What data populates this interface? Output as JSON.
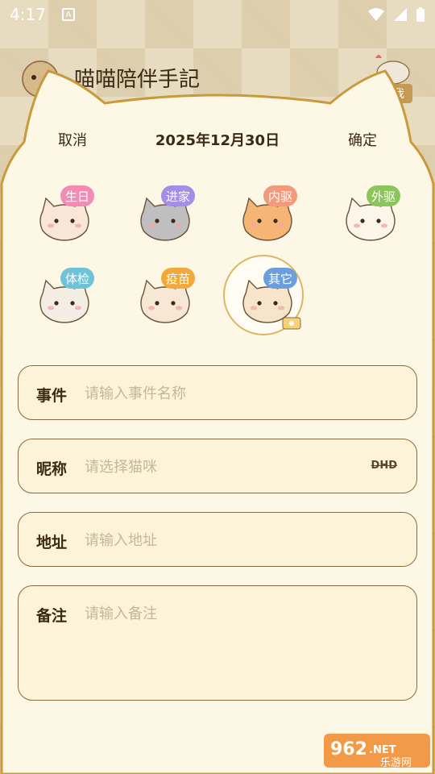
{
  "status_bar": {
    "time": "4:17",
    "notification_icon": "A"
  },
  "app": {
    "title_partial": "喵喵陪伴手記",
    "me_button": "我"
  },
  "picker": {
    "cancel": "取消",
    "date": "2025年12月30日",
    "confirm": "确定"
  },
  "event_types": [
    {
      "label": "生日",
      "color": "#f28cb5",
      "cat_color": "#f8e6d8",
      "selected": false
    },
    {
      "label": "进家",
      "color": "#a38ee8",
      "cat_color": "#bfbfbf",
      "selected": false
    },
    {
      "label": "内驱",
      "color": "#f49a7c",
      "cat_color": "#f5b574",
      "selected": false
    },
    {
      "label": "外驱",
      "color": "#8bc65c",
      "cat_color": "#fbf5ea",
      "selected": false
    },
    {
      "label": "体检",
      "color": "#6fc3d8",
      "cat_color": "#f3ede4",
      "selected": false
    },
    {
      "label": "疫苗",
      "color": "#f2a93a",
      "cat_color": "#f6e8d4",
      "selected": false
    },
    {
      "label": "其它",
      "color": "#6c9ede",
      "cat_color": "#f6e5c8",
      "selected": true
    }
  ],
  "fields": {
    "event": {
      "label": "事件",
      "placeholder": "请输入事件名称",
      "value": ""
    },
    "nickname": {
      "label": "昵称",
      "placeholder": "请选择猫咪",
      "value": "",
      "suffix": "DHD"
    },
    "address": {
      "label": "地址",
      "placeholder": "请输入地址",
      "value": ""
    },
    "remark": {
      "label": "备注",
      "placeholder": "请输入备注",
      "value": ""
    }
  },
  "watermark": {
    "number": "962",
    "suffix": ".NET",
    "site": "乐游网"
  },
  "colors": {
    "sheet_bg": "#fdf8e6",
    "sheet_border": "#c89a3c",
    "field_bg": "#fdf3d8",
    "field_border": "#8a6a3a",
    "text_dark": "#3b2a14",
    "placeholder": "#c5b79a"
  }
}
